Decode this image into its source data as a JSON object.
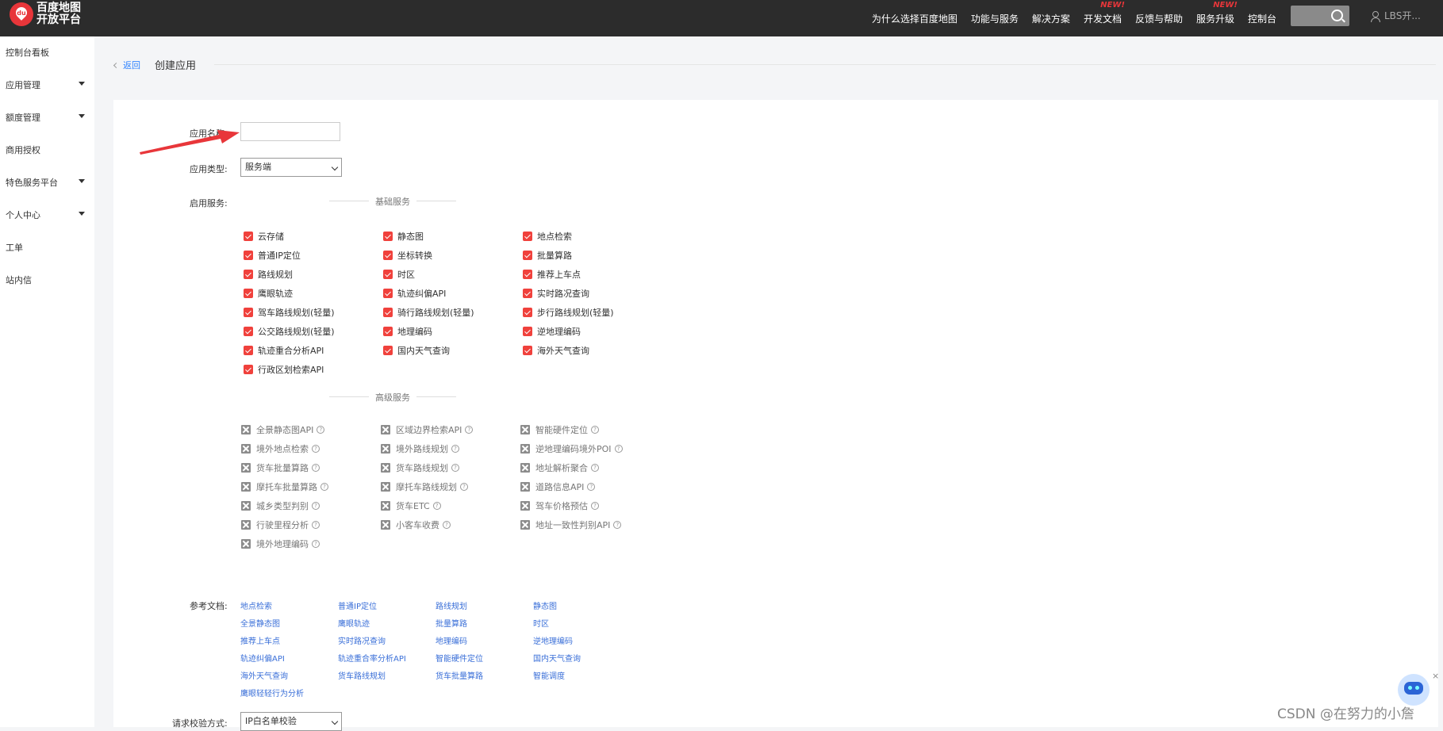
{
  "header": {
    "logo_badge": "du",
    "logo_line1": "百度地图",
    "logo_line2": "开放平台",
    "nav": [
      {
        "label": "为什么选择百度地图",
        "badge": ""
      },
      {
        "label": "功能与服务",
        "badge": ""
      },
      {
        "label": "解决方案",
        "badge": ""
      },
      {
        "label": "开发文档",
        "badge": "NEW!"
      },
      {
        "label": "反馈与帮助",
        "badge": ""
      },
      {
        "label": "服务升级",
        "badge": "NEW!"
      },
      {
        "label": "控制台",
        "badge": ""
      }
    ],
    "user": "LBS开..."
  },
  "sidebar": {
    "items": [
      {
        "label": "控制台看板",
        "expandable": false
      },
      {
        "label": "应用管理",
        "expandable": true
      },
      {
        "label": "额度管理",
        "expandable": true
      },
      {
        "label": "商用授权",
        "expandable": false
      },
      {
        "label": "特色服务平台",
        "expandable": true
      },
      {
        "label": "个人中心",
        "expandable": true
      },
      {
        "label": "工单",
        "expandable": false
      },
      {
        "label": "站内信",
        "expandable": false
      }
    ]
  },
  "breadcrumb": {
    "back": "返回",
    "title": "创建应用"
  },
  "form": {
    "app_name_label": "应用名称:",
    "app_name_value": "",
    "app_type_label": "应用类型:",
    "app_type_value": "服务端",
    "services_label": "启用服务:",
    "basic_title": "基础服务",
    "basic_services": [
      [
        "云存储",
        "静态图",
        "地点检索"
      ],
      [
        "普通IP定位",
        "坐标转换",
        "批量算路"
      ],
      [
        "路线规划",
        "时区",
        "推荐上车点"
      ],
      [
        "鹰眼轨迹",
        "轨迹纠偏API",
        "实时路况查询"
      ],
      [
        "驾车路线规划(轻量)",
        "骑行路线规划(轻量)",
        "步行路线规划(轻量)"
      ],
      [
        "公交路线规划(轻量)",
        "地理编码",
        "逆地理编码"
      ],
      [
        "轨迹重合分析API",
        "国内天气查询",
        "海外天气查询"
      ],
      [
        "行政区划检索API"
      ]
    ],
    "advanced_title": "高级服务",
    "advanced_services": [
      [
        "全景静态图API",
        "区域边界检索API",
        "智能硬件定位"
      ],
      [
        "境外地点检索",
        "境外路线规划",
        "逆地理编码境外POI"
      ],
      [
        "货车批量算路",
        "货车路线规划",
        "地址解析聚合"
      ],
      [
        "摩托车批量算路",
        "摩托车路线规划",
        "道路信息API"
      ],
      [
        "城乡类型判别",
        "货车ETC",
        "驾车价格预估"
      ],
      [
        "行驶里程分析",
        "小客车收费",
        "地址一致性判别API"
      ],
      [
        "境外地理编码"
      ]
    ],
    "help_glyph": "?",
    "docs_label": "参考文档:",
    "docs": [
      [
        "地点检索",
        "普通IP定位",
        "路线规划",
        "静态图"
      ],
      [
        "全景静态图",
        "鹰眼轨迹",
        "批量算路",
        "时区"
      ],
      [
        "推荐上车点",
        "实时路况查询",
        "地理编码",
        "逆地理编码"
      ],
      [
        "轨迹纠偏API",
        "轨迹重合率分析API",
        "智能硬件定位",
        "国内天气查询"
      ],
      [
        "海外天气查询",
        "货车路线规划",
        "货车批量算路",
        "智能调度"
      ],
      [
        "鹰眼轻轻行为分析"
      ]
    ],
    "verify_label": "请求校验方式:",
    "verify_value": "IP白名单校验"
  },
  "assistant": {
    "close": "×"
  },
  "watermark": "CSDN @在努力的小詹",
  "colors": {
    "accent": "#f0413c",
    "link": "#3a6fd8",
    "topbar": "#2c2c2c"
  }
}
